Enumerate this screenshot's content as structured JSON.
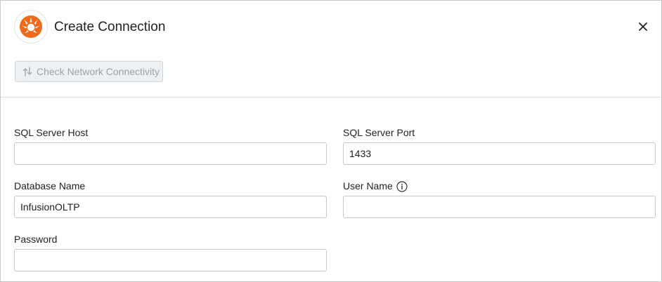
{
  "dialog": {
    "title": "Create Connection",
    "check_button_label": "Check Network Connectivity"
  },
  "form": {
    "sql_server_host": {
      "label": "SQL Server Host",
      "value": "",
      "placeholder": ""
    },
    "sql_server_port": {
      "label": "SQL Server Port",
      "value": "1433",
      "placeholder": ""
    },
    "database_name": {
      "label": "Database Name",
      "value": "InfusionOLTP",
      "placeholder": ""
    },
    "user_name": {
      "label": "User Name",
      "value": "",
      "placeholder": ""
    },
    "password": {
      "label": "Password",
      "value": "",
      "placeholder": ""
    }
  },
  "icons": {
    "logo": "brand-logo-icon",
    "close": "close-icon",
    "check": "network-connectivity-icon",
    "info": "info-icon"
  },
  "colors": {
    "brand_orange": "#ef6a1a",
    "disabled_text": "#9aa3ac",
    "disabled_bg": "#eef1f4"
  }
}
